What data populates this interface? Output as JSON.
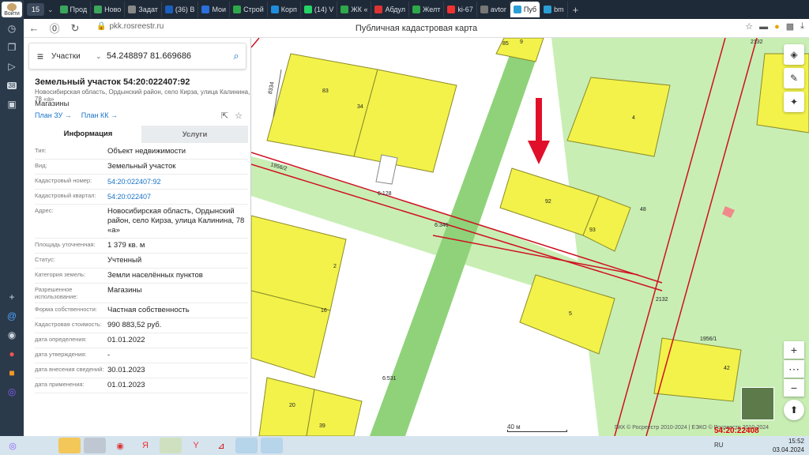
{
  "os_sidebar": {
    "login_label": "Войти",
    "icons": [
      "clock-icon",
      "copy-icon",
      "play-icon",
      "calendar-icon",
      "layers-icon",
      "plus-icon",
      "mail-icon",
      "record-icon",
      "map-pin-icon",
      "briefcase-icon",
      "assistant-icon"
    ],
    "calendar_day": "38"
  },
  "browser": {
    "tab_count": "15",
    "tabs": [
      {
        "label": "Прод",
        "color": "#3ba55c"
      },
      {
        "label": "Ново",
        "color": "#3ba55c"
      },
      {
        "label": "Задат",
        "color": "#888888"
      },
      {
        "label": "(36) В",
        "color": "#1a5fbf"
      },
      {
        "label": "Мои",
        "color": "#2a6fdb"
      },
      {
        "label": "Строй",
        "color": "#2ea84a"
      },
      {
        "label": "Корп",
        "color": "#1f8ddb"
      },
      {
        "label": "(14) V",
        "color": "#25d366"
      },
      {
        "label": "ЖК «",
        "color": "#2ea84a"
      },
      {
        "label": "Абдул",
        "color": "#d33"
      },
      {
        "label": "Желт",
        "color": "#2ea84a"
      },
      {
        "label": "ki-67",
        "color": "#e33"
      },
      {
        "label": "avtor",
        "color": "#777777"
      },
      {
        "label": "Пуб",
        "color": "#2a9fd6",
        "active": true
      },
      {
        "label": "bm",
        "color": "#2a9fd6"
      }
    ],
    "url": "pkk.rosreestr.ru",
    "page_title": "Публичная кадастровая карта"
  },
  "search": {
    "type": "Участки",
    "coords": "54.248897 81.669686"
  },
  "parcel": {
    "title": "Земельный участок 54:20:022407:92",
    "address_short": "Новосибирская область, Ордынский район, село Кирза, улица Калинина, 78 «а»",
    "kind": "Магазины",
    "plan_zu": "План ЗУ →",
    "plan_kk": "План КК →",
    "tab_info": "Информация",
    "tab_services": "Услуги",
    "rows": [
      {
        "k": "Тип:",
        "v": "Объект недвижимости"
      },
      {
        "k": "Вид:",
        "v": "Земельный участок"
      },
      {
        "k": "Кадастровый номер:",
        "v": "54:20:022407:92",
        "link": true
      },
      {
        "k": "Кадастровый квартал:",
        "v": "54:20:022407",
        "link": true
      },
      {
        "k": "Адрес:",
        "v": "Новосибирская область, Ордынский район, село Кирза, улица Калинина, 78 «а»"
      },
      {
        "k": "Площадь уточненная:",
        "v": "1 379 кв. м"
      },
      {
        "k": "Статус:",
        "v": "Учтенный"
      },
      {
        "k": "Категория земель:",
        "v": "Земли населённых пунктов"
      },
      {
        "k": "Разрешенное использование:",
        "v": "Магазины"
      },
      {
        "k": "Форма собственности:",
        "v": "Частная собственность"
      },
      {
        "k": "Кадастровая стоимость:",
        "v": "990 883,52 руб."
      },
      {
        "k": "дата определения:",
        "v": "01.01.2022"
      },
      {
        "k": "дата утверждения:",
        "v": "-"
      },
      {
        "k": "дата внесения сведений:",
        "v": "30.01.2023"
      },
      {
        "k": "дата применения:",
        "v": "01.01.2023"
      }
    ]
  },
  "map": {
    "parcel_labels": [
      "85",
      "9",
      "83",
      "34",
      "4",
      "2132",
      "8334",
      "92",
      "93",
      "2",
      "16",
      "5",
      "42",
      "20",
      "39",
      "6:346",
      "6:128",
      "6:531",
      "2132",
      "1956/2",
      "1956/1",
      "48"
    ],
    "scale_label": "40 м",
    "copyright": "ПКК © Росреестр 2010-2024 | ЕЭКО © Росреестр 2010-2024",
    "cad_code": "54:20:22408"
  },
  "taskbar": {
    "lang": "RU",
    "time": "15:52",
    "date": "03.04.2024"
  },
  "colors": {
    "parcel_fill": "#f2f24a",
    "green_zone": "#a8e08c",
    "red_line": "#d01020",
    "accent": "#1a73c8"
  }
}
